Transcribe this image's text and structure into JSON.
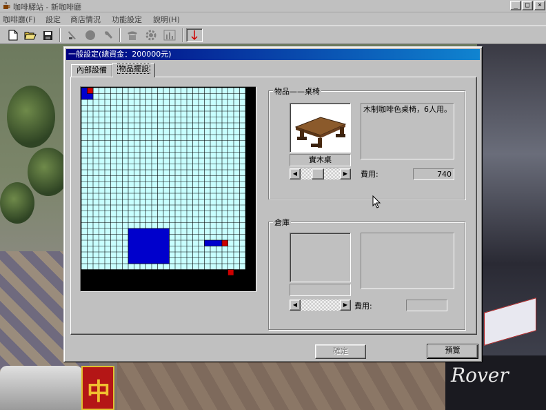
{
  "app": {
    "title": "咖啡驛站 - 新咖啡廳",
    "min_glyph": "_",
    "max_glyph": "□",
    "close_glyph": "×"
  },
  "menu": {
    "items": [
      "咖啡廳(F)",
      "設定",
      "商店情況",
      "功能設定",
      "說明(H)"
    ]
  },
  "toolbar": {
    "icons": [
      "new-file-icon",
      "open-folder-icon",
      "save-disk-icon",
      "knife-icon",
      "circle-icon",
      "wrench-icon",
      "phone-icon",
      "gear-icon",
      "chart-icon",
      "red-arrow-icon"
    ]
  },
  "scene": {
    "sign_red_text": "中",
    "sign_rover_text": "Rover"
  },
  "dialog": {
    "title": "一般設定(總資金：200000元)",
    "tabs": [
      "內部設備",
      "物品擺設"
    ],
    "active_tab": 1,
    "grid": {
      "cols": 28,
      "rows": 31,
      "cell_color": "#c8ffff",
      "line_color": "#000000",
      "placed_color": "#0000cc",
      "marker_color": "#cc0000"
    },
    "item_group": {
      "label": "物品——桌椅",
      "description": "木制咖啡色桌椅，6人用。",
      "name": "實木桌",
      "cost_label": "費用:",
      "cost_value": "740",
      "scroll_left": "◀",
      "scroll_right": "▶"
    },
    "storage_group": {
      "label": "倉庫",
      "description": "",
      "name": "",
      "cost_label": "費用:",
      "cost_value": "",
      "scroll_left": "◀",
      "scroll_right": "▶"
    },
    "ok_button": "確定",
    "preview_button": "預覽"
  }
}
